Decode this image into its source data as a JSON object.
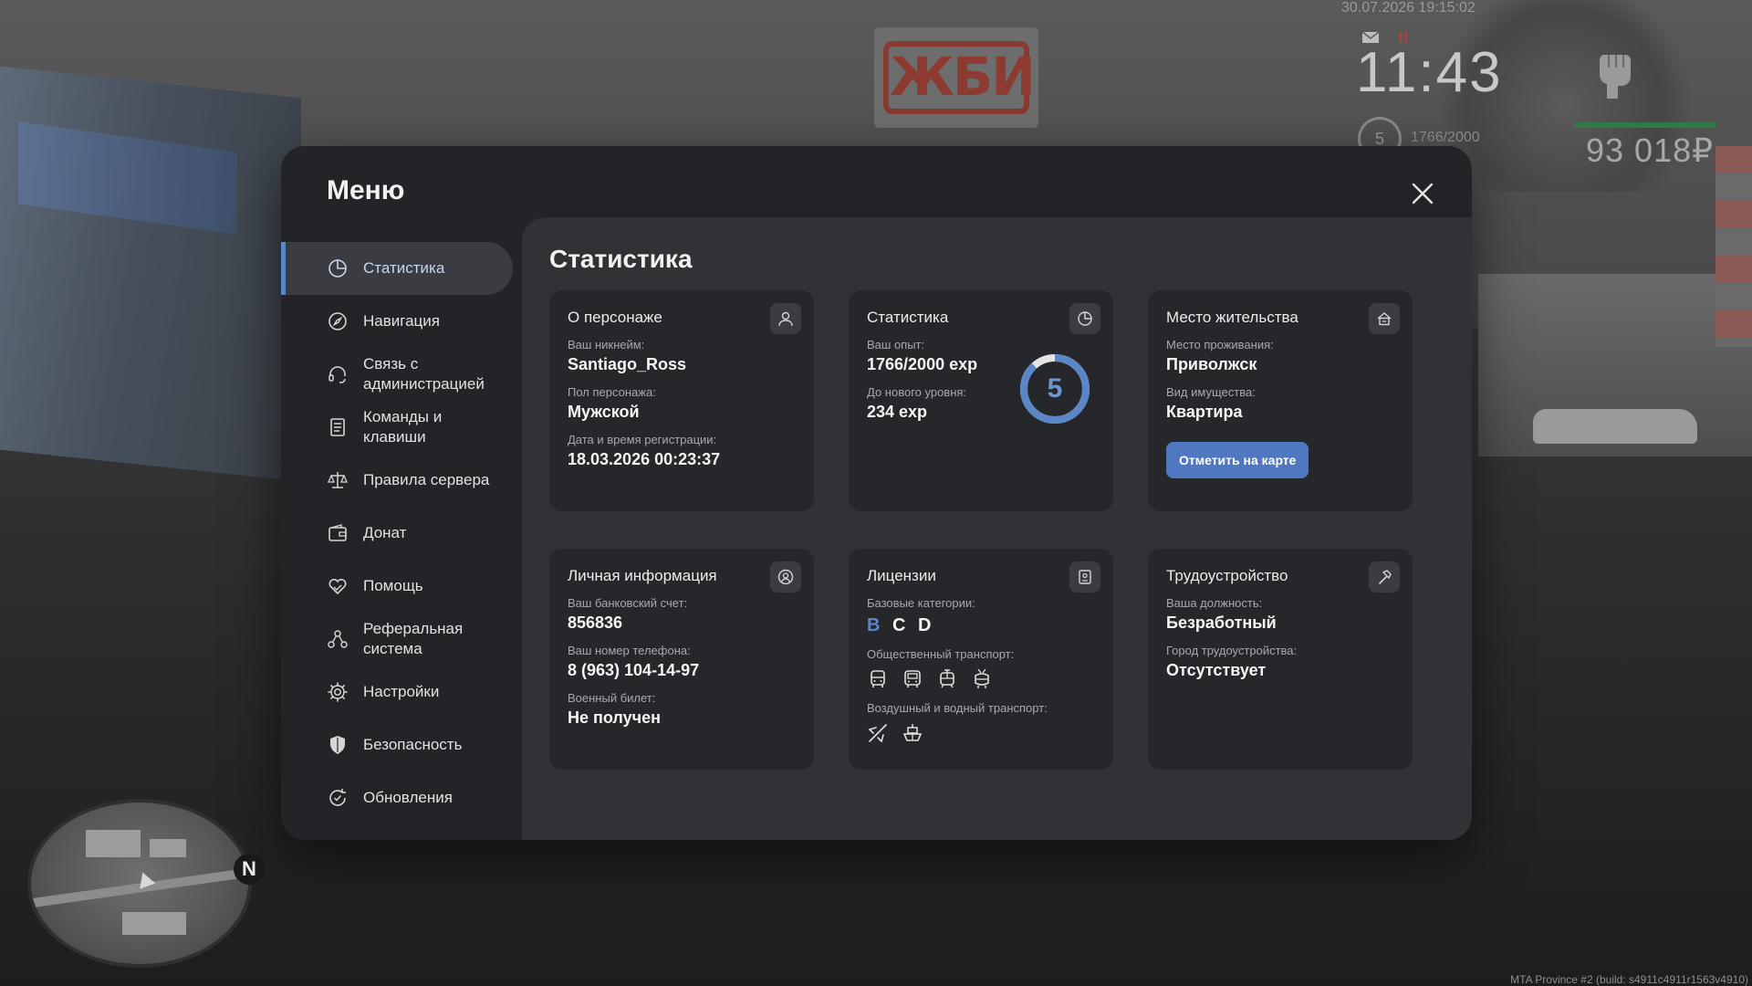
{
  "hud": {
    "datetime": "30.07.2026 19:15:02",
    "clock": "11:43",
    "level": "5",
    "exp": "1766/2000",
    "money": "93 018₽",
    "build": "MTA Province #2 (build: s4911c4911r1563v4910)",
    "alert": "!!",
    "minimap_north": "N",
    "billboard_text": "ЖБИ"
  },
  "menu": {
    "title": "Меню",
    "sidebar": [
      {
        "label": "Статистика",
        "icon": "stats-icon",
        "active": true
      },
      {
        "label": "Навигация",
        "icon": "compass-icon"
      },
      {
        "label": "Связь с\nадминистрацией",
        "icon": "headset-icon"
      },
      {
        "label": "Команды и\nклавиши",
        "icon": "document-icon"
      },
      {
        "label": "Правила сервера",
        "icon": "scales-icon"
      },
      {
        "label": "Донат",
        "icon": "wallet-icon"
      },
      {
        "label": "Помощь",
        "icon": "heart-hand-icon"
      },
      {
        "label": "Реферальная\nсистема",
        "icon": "referral-icon"
      },
      {
        "label": "Настройки",
        "icon": "gear-icon"
      },
      {
        "label": "Безопасность",
        "icon": "shield-icon"
      },
      {
        "label": "Обновления",
        "icon": "refresh-icon"
      }
    ]
  },
  "content": {
    "title": "Статистика",
    "character": {
      "title": "О персонаже",
      "nick_label": "Ваш никнейм:",
      "nick": "Santiago_Ross",
      "gender_label": "Пол персонажа:",
      "gender": "Мужской",
      "reg_label": "Дата и время регистрации:",
      "reg": "18.03.2026 00:23:37"
    },
    "stats": {
      "title": "Статистика",
      "exp_label": "Ваш опыт:",
      "exp": "1766/2000 exp",
      "next_label": "До нового уровня:",
      "next": "234 exp",
      "level": "5",
      "progress": 0.883,
      "ring_color": "#5b86c8"
    },
    "residence": {
      "title": "Место жительства",
      "place_label": "Место проживания:",
      "place": "Приволжск",
      "property_label": "Вид имущества:",
      "property": "Квартира",
      "button": "Отметить на карте"
    },
    "personal": {
      "title": "Личная информация",
      "bank_label": "Ваш банковский счет:",
      "bank": "856836",
      "phone_label": "Ваш номер телефона:",
      "phone": "8 (963) 104-14-97",
      "military_label": "Военный билет:",
      "military": "Не получен"
    },
    "licenses": {
      "title": "Лицензии",
      "base_label": "Базовые категории:",
      "categories": [
        "B",
        "C",
        "D"
      ],
      "public_label": "Общественный транспорт:",
      "public_icons": [
        "bus-icon",
        "coach-icon",
        "tram-icon",
        "trolleybus-icon"
      ],
      "air_label": "Воздушный и водный транспорт:",
      "air_icons": [
        "plane-icon",
        "boat-icon"
      ]
    },
    "employment": {
      "title": "Трудоустройство",
      "position_label": "Ваша должность:",
      "position": "Безработный",
      "city_label": "Город трудоустройства:",
      "city": "Отсутствует"
    }
  },
  "colors": {
    "accent": "#5b86c8",
    "button": "#4f78c0",
    "health": "#2f7a47"
  }
}
